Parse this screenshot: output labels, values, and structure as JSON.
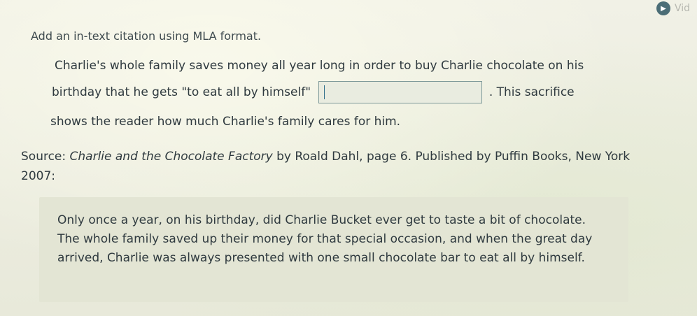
{
  "video_button": {
    "label": "Vid",
    "icon": "play-icon"
  },
  "instruction": "Add an in-text citation using MLA format.",
  "passage": {
    "line1": "Charlie's whole family saves money all year long in order to buy Charlie chocolate on his",
    "line2_before": "birthday that he gets \"to eat all by himself\"",
    "answer_value": "",
    "line2_after": ". This sacrifice",
    "line3": "shows the reader how much Charlie's family cares for him."
  },
  "source": {
    "prefix": "Source: ",
    "title": "Charlie and the Chocolate Factory",
    "suffix": " by Roald Dahl, page 6. Published by Puffin Books, New York 2007:"
  },
  "quote": "Only once a year, on his birthday, did Charlie Bucket ever get to taste a bit of chocolate. The whole family saved up their money for that special occasion, and when the great day arrived, Charlie was always presented with one small chocolate bar to eat all by himself."
}
